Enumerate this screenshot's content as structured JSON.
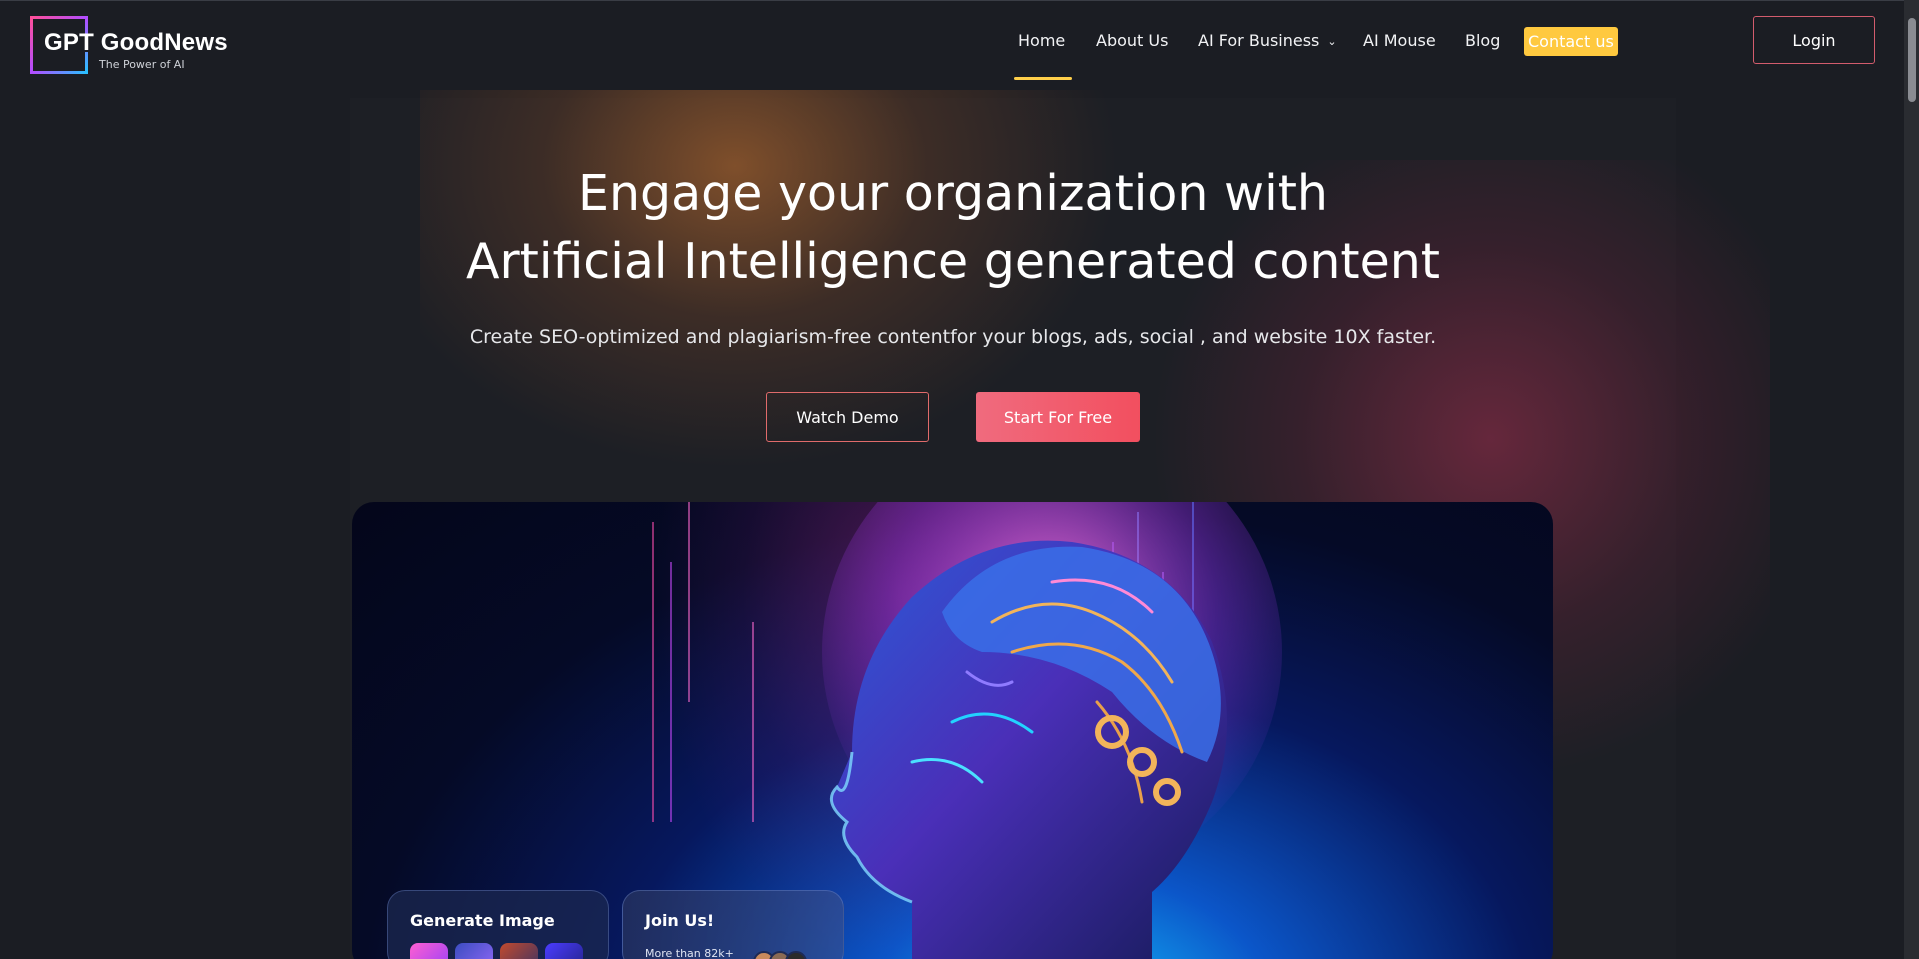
{
  "header": {
    "logo_title": "GPT GoodNews",
    "logo_tagline": "The Power of AI",
    "nav": {
      "home": "Home",
      "about": "About Us",
      "business": "AI For Business",
      "mouse": "AI Mouse",
      "blog": "Blog",
      "contact": "Contact us"
    },
    "login_label": "Login"
  },
  "hero": {
    "title_line1": "Engage your organization with",
    "title_line2": "Artificial Intelligence generated content",
    "subtitle": "Create SEO-optimized and plagiarism-free contentfor your blogs, ads, social , and website 10X faster.",
    "watch_demo_label": "Watch Demo",
    "start_free_label": "Start For Free"
  },
  "showcase": {
    "generate_card_title": "Generate Image",
    "join_card_title": "Join Us!",
    "join_card_subtitle": "More than 82k+"
  },
  "colors": {
    "background": "#1b1d23",
    "accent_yellow": "#ffc93f",
    "accent_pink": "#f24f5f",
    "nav_underline": "#ffcf4a"
  }
}
